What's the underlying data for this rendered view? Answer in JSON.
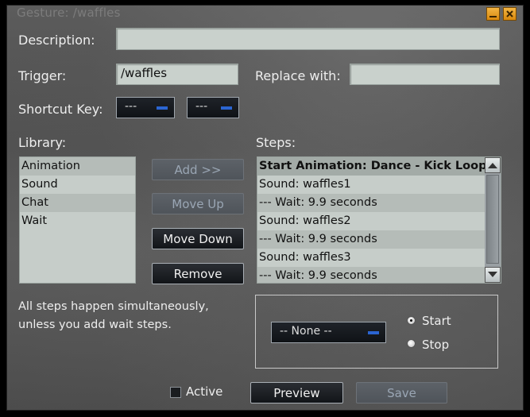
{
  "window": {
    "title": "Gesture: /waffles"
  },
  "labels": {
    "description": "Description:",
    "trigger": "Trigger:",
    "replace_with": "Replace with:",
    "shortcut_key": "Shortcut Key:",
    "library": "Library:",
    "steps": "Steps:"
  },
  "fields": {
    "description": "",
    "trigger": "/waffles",
    "replace_with": ""
  },
  "shortcut": {
    "modifier": "---",
    "key": "---"
  },
  "library": {
    "items": [
      "Animation",
      "Sound",
      "Chat",
      "Wait"
    ]
  },
  "steps": {
    "items": [
      "Start Animation: Dance - Kick Loop",
      "Sound: waffles1",
      "--- Wait: 9.9 seconds",
      "Sound: waffles2",
      "--- Wait: 9.9 seconds",
      "Sound: waffles3",
      "--- Wait: 9.9 seconds"
    ]
  },
  "buttons": {
    "add": "Add >>",
    "move_up": "Move Up",
    "move_down": "Move Down",
    "remove": "Remove",
    "preview": "Preview",
    "save": "Save"
  },
  "note": {
    "line1": "All steps happen simultaneously,",
    "line2": "unless you add wait steps."
  },
  "options": {
    "animation": "-- None --",
    "start": "Start",
    "stop": "Stop"
  },
  "active_label": "Active",
  "colors": {
    "window_button": "#e8a22a",
    "combo_indicator": "#2b65d2"
  }
}
